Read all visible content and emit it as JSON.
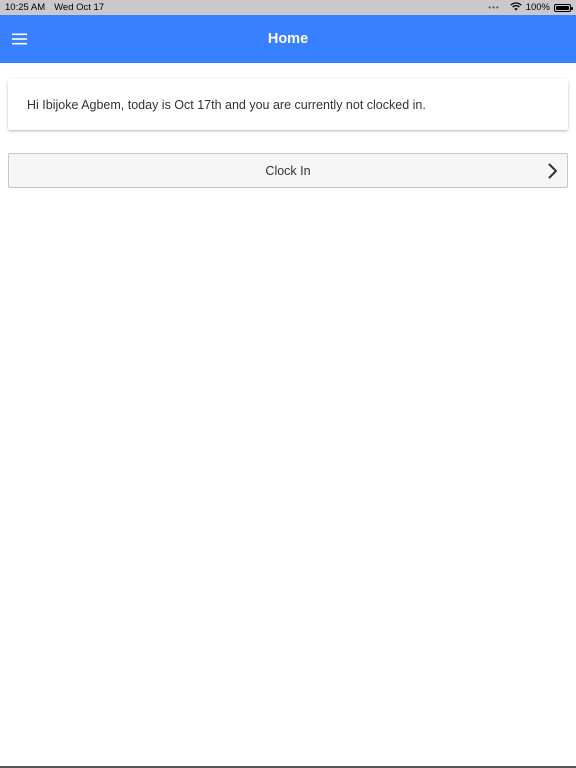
{
  "status_bar": {
    "time": "10:25 AM",
    "date": "Wed Oct 17",
    "battery": "100%",
    "icons": [
      "multitask-dots-icon",
      "wifi-icon",
      "battery-icon"
    ]
  },
  "app_bar": {
    "title": "Home",
    "menu_icon": "hamburger-menu-icon",
    "color": "#3880ff"
  },
  "greeting": {
    "text": "Hi Ibijoke Agbem, today is Oct 17th and you are currently not clocked in."
  },
  "clock_in": {
    "label": "Clock In",
    "icon": "chevron-right-icon"
  }
}
